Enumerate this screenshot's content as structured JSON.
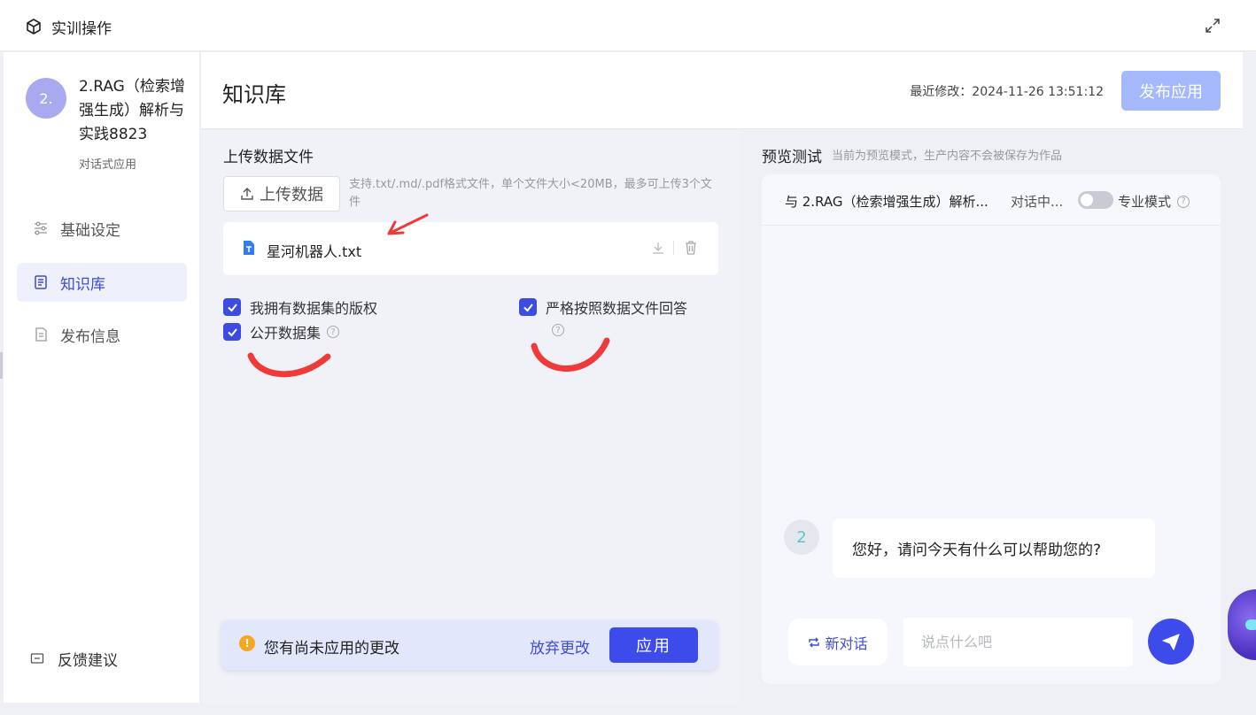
{
  "window": {
    "title": "实训操作"
  },
  "sidebar": {
    "avatar_text": "2.",
    "app_name": "2.RAG（检索增强生成）解析与实践8823",
    "app_type": "对话式应用",
    "items": [
      {
        "label": "基础设定",
        "icon": "sliders-icon",
        "active": false
      },
      {
        "label": "知识库",
        "icon": "book-icon",
        "active": true
      },
      {
        "label": "发布信息",
        "icon": "publish-doc-icon",
        "active": false
      }
    ],
    "feedback_label": "反馈建议"
  },
  "header": {
    "title": "知识库",
    "modified": "最近修改：2024-11-26 13:51:12",
    "publish_label": "发布应用"
  },
  "knowledge": {
    "section_title": "上传数据文件",
    "upload_label": "上传数据",
    "upload_hint": "支持.txt/.md/.pdf格式文件，单个文件大小<20MB，最多可上传3个文件",
    "file_name": "星河机器人.txt",
    "checks": {
      "copyright": "我拥有数据集的版权",
      "public": "公开数据集",
      "strict": "严格按照数据文件回答"
    },
    "unsaved": {
      "message": "您有尚未应用的更改",
      "discard": "放弃更改",
      "apply": "应用"
    }
  },
  "preview": {
    "title": "预览测试",
    "subtitle": "当前为预览模式，生产内容不会被保存为作品",
    "chat_with": "与  2.RAG（检索增强生成）解析...",
    "status": "对话中...",
    "pro_mode": "专业模式",
    "bot_avatar": "2",
    "greeting": "您好，请问今天有什么可以帮助您的?",
    "new_chat": "新对话",
    "input_placeholder": "说点什么吧"
  },
  "colors": {
    "accent": "#3d4bea",
    "publish_disabled": "#a4b8fb",
    "warning": "#f5a623"
  }
}
